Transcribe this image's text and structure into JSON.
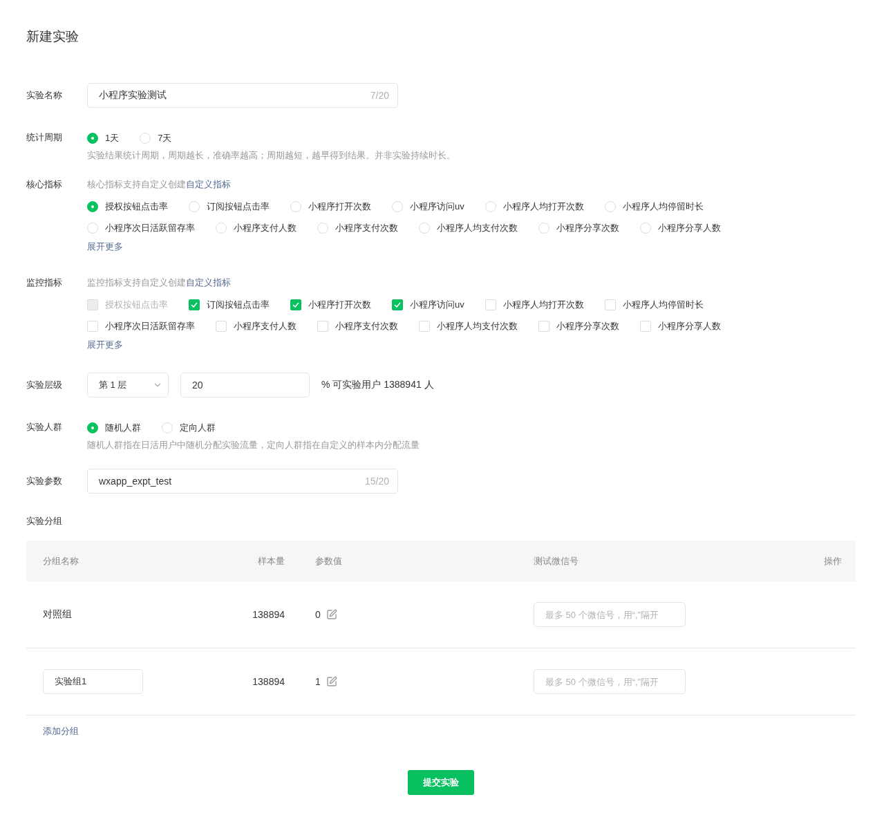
{
  "page_title": "新建实验",
  "name_field": {
    "label": "实验名称",
    "value": "小程序实验测试",
    "counter": "7/20"
  },
  "period": {
    "label": "统计周期",
    "options": [
      {
        "label": "1天",
        "selected": true
      },
      {
        "label": "7天",
        "selected": false
      }
    ],
    "hint": "实验结果统计周期，周期越长，准确率越高；周期越短，越早得到结果。并非实验持续时长。"
  },
  "core_metrics": {
    "label": "核心指标",
    "hint": "核心指标支持自定义创建",
    "hint_link": "自定义指标",
    "rows": [
      [
        {
          "label": "授权按钮点击率",
          "selected": true
        },
        {
          "label": "订阅按钮点击率",
          "selected": false
        },
        {
          "label": "小程序打开次数",
          "selected": false
        },
        {
          "label": "小程序访问uv",
          "selected": false
        },
        {
          "label": "小程序人均打开次数",
          "selected": false
        },
        {
          "label": "小程序人均停留时长",
          "selected": false
        }
      ],
      [
        {
          "label": "小程序次日活跃留存率",
          "selected": false
        },
        {
          "label": "小程序支付人数",
          "selected": false
        },
        {
          "label": "小程序支付次数",
          "selected": false
        },
        {
          "label": "小程序人均支付次数",
          "selected": false
        },
        {
          "label": "小程序分享次数",
          "selected": false
        },
        {
          "label": "小程序分享人数",
          "selected": false
        }
      ]
    ],
    "more": "展开更多"
  },
  "monitor_metrics": {
    "label": "监控指标",
    "hint": "监控指标支持自定义创建",
    "hint_link": "自定义指标",
    "rows": [
      [
        {
          "label": "授权按钮点击率",
          "checked": false,
          "disabled": true
        },
        {
          "label": "订阅按钮点击率",
          "checked": true,
          "disabled": false
        },
        {
          "label": "小程序打开次数",
          "checked": true,
          "disabled": false
        },
        {
          "label": "小程序访问uv",
          "checked": true,
          "disabled": false
        },
        {
          "label": "小程序人均打开次数",
          "checked": false,
          "disabled": false
        },
        {
          "label": "小程序人均停留时长",
          "checked": false,
          "disabled": false
        }
      ],
      [
        {
          "label": "小程序次日活跃留存率",
          "checked": false,
          "disabled": false
        },
        {
          "label": "小程序支付人数",
          "checked": false,
          "disabled": false
        },
        {
          "label": "小程序支付次数",
          "checked": false,
          "disabled": false
        },
        {
          "label": "小程序人均支付次数",
          "checked": false,
          "disabled": false
        },
        {
          "label": "小程序分享次数",
          "checked": false,
          "disabled": false
        },
        {
          "label": "小程序分享人数",
          "checked": false,
          "disabled": false
        }
      ]
    ],
    "more": "展开更多"
  },
  "layer": {
    "label": "实验层级",
    "select": "第 1 层",
    "percent": "20",
    "note": "% 可实验用户 1388941 人"
  },
  "audience": {
    "label": "实验人群",
    "options": [
      {
        "label": "随机人群",
        "selected": true
      },
      {
        "label": "定向人群",
        "selected": false
      }
    ],
    "hint": "随机人群指在日活用户中随机分配实验流量，定向人群指在自定义的样本内分配流量"
  },
  "param_field": {
    "label": "实验参数",
    "value": "wxapp_expt_test",
    "counter": "15/20"
  },
  "groups": {
    "label": "实验分组",
    "columns": [
      "分组名称",
      "样本量",
      "参数值",
      "测试微信号",
      "操作"
    ],
    "rows": [
      {
        "kind": "text",
        "name": "对照组",
        "samples": "138894",
        "param": "0",
        "wechat_placeholder": "最多 50 个微信号，用“,”隔开"
      },
      {
        "kind": "input",
        "name": "实验组1",
        "samples": "138894",
        "param": "1",
        "wechat_placeholder": "最多 50 个微信号，用“,”隔开"
      }
    ],
    "add": "添加分组"
  },
  "submit": "提交实验"
}
